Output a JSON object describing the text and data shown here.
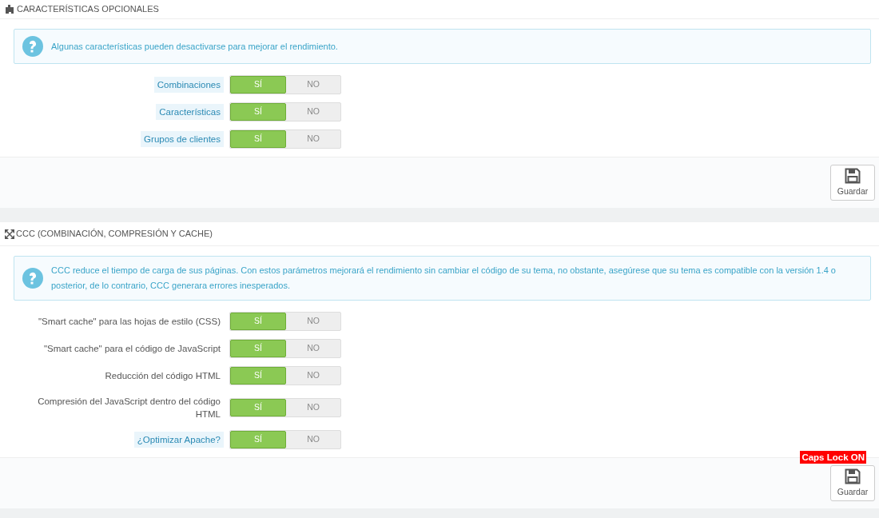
{
  "sections": [
    {
      "title": "CARACTERÍSTICAS OPCIONALES",
      "info": "Algunas características pueden desactivarse para mejorar el rendimiento.",
      "options": [
        {
          "label": "Combinaciones",
          "hint": true,
          "on": true,
          "yes": "SÍ",
          "no": "NO"
        },
        {
          "label": "Características",
          "hint": true,
          "on": true,
          "yes": "SÍ",
          "no": "NO"
        },
        {
          "label": "Grupos de clientes",
          "hint": true,
          "on": true,
          "yes": "SÍ",
          "no": "NO"
        }
      ],
      "save": "Guardar"
    },
    {
      "title": "CCC (COMBINACIÓN, COMPRESIÓN Y CACHE)",
      "info": "CCC reduce el tiempo de carga de sus páginas. Con estos parámetros mejorará el rendimiento sin cambiar el código de su tema, no obstante, asegúrese que su tema es compatible con la versión 1.4 o posterior, de lo contrario, CCC generara errores inesperados.",
      "options": [
        {
          "label": "\"Smart cache\" para las hojas de estilo (CSS)",
          "hint": false,
          "on": true,
          "yes": "SÍ",
          "no": "NO"
        },
        {
          "label": "\"Smart cache\" para el código de JavaScript",
          "hint": false,
          "on": true,
          "yes": "SÍ",
          "no": "NO"
        },
        {
          "label": "Reducción del código HTML",
          "hint": false,
          "on": true,
          "yes": "SÍ",
          "no": "NO"
        },
        {
          "label": "Compresión del JavaScript dentro del código HTML",
          "hint": false,
          "on": true,
          "yes": "SÍ",
          "no": "NO"
        },
        {
          "label": "¿Optimizar Apache?",
          "hint": true,
          "on": true,
          "yes": "SÍ",
          "no": "NO"
        }
      ],
      "badge": "Caps Lock ON",
      "save": "Guardar"
    }
  ]
}
